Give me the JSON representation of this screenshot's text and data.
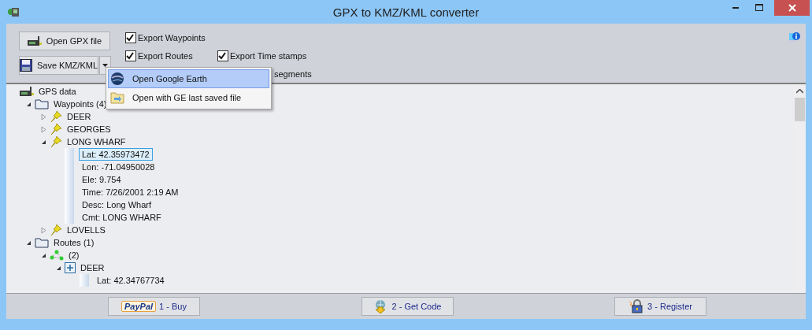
{
  "window": {
    "title": "GPX to KMZ/KML converter"
  },
  "toolbar": {
    "open_button": "Open GPX file",
    "save_button": "Save KMZ/KML",
    "options": [
      {
        "kind": "checkbox",
        "label": "Export Waypoints",
        "checked": true
      },
      {
        "kind": "checkbox",
        "label": "Export Routes",
        "checked": true
      },
      {
        "kind": "checkbox",
        "label": "Export Time stamps",
        "checked": true
      },
      {
        "kind": "text",
        "label": "segments"
      }
    ]
  },
  "menu": {
    "items": [
      {
        "kind": "globe",
        "label": "Open Google Earth",
        "selected": true
      },
      {
        "kind": "folder",
        "label": "Open with GE last saved file",
        "selected": false
      }
    ]
  },
  "tree": [
    {
      "kind": "gps",
      "label": "GPS data",
      "selected": false,
      "children": [
        {
          "kind": "folder",
          "label": "Waypoints (4)",
          "expanded": true,
          "selected": false,
          "children": [
            {
              "kind": "pin",
              "label": "DEER",
              "expanded": false,
              "selected": false
            },
            {
              "kind": "pin",
              "label": "GEORGES",
              "expanded": false,
              "selected": false
            },
            {
              "kind": "pin",
              "label": "LONG WHARF",
              "expanded": true,
              "selected": false,
              "children": [
                {
                  "kind": "field",
                  "label": "Lat: 42.35973472",
                  "selected": true
                },
                {
                  "kind": "field",
                  "label": "Lon: -71.04950028",
                  "selected": false
                },
                {
                  "kind": "field",
                  "label": "Ele: 9.754",
                  "selected": false
                },
                {
                  "kind": "field",
                  "label": "Time: 7/26/2001 2:19 AM",
                  "selected": false
                },
                {
                  "kind": "field",
                  "label": "Desc: Long Wharf",
                  "selected": false
                },
                {
                  "kind": "field",
                  "label": "Cmt: LONG WHARF",
                  "selected": false
                }
              ]
            },
            {
              "kind": "pin",
              "label": "LOVELLS",
              "expanded": false,
              "selected": false
            }
          ]
        },
        {
          "kind": "folder",
          "label": "Routes (1)",
          "expanded": true,
          "selected": false,
          "children": [
            {
              "kind": "route",
              "label": "(2)",
              "expanded": true,
              "selected": false,
              "children": [
                {
                  "kind": "point",
                  "label": "DEER",
                  "expanded": true,
                  "selected": false,
                  "children": [
                    {
                      "kind": "field",
                      "label": "Lat: 42.34767734",
                      "selected": false
                    }
                  ]
                }
              ]
            }
          ]
        }
      ]
    }
  ],
  "footer": {
    "buttons": [
      {
        "kind": "paypal",
        "badge": "PayPal",
        "label": "1 - Buy"
      },
      {
        "kind": "download",
        "label": "2 - Get Code"
      },
      {
        "kind": "lock",
        "label": "3 - Register"
      }
    ]
  }
}
